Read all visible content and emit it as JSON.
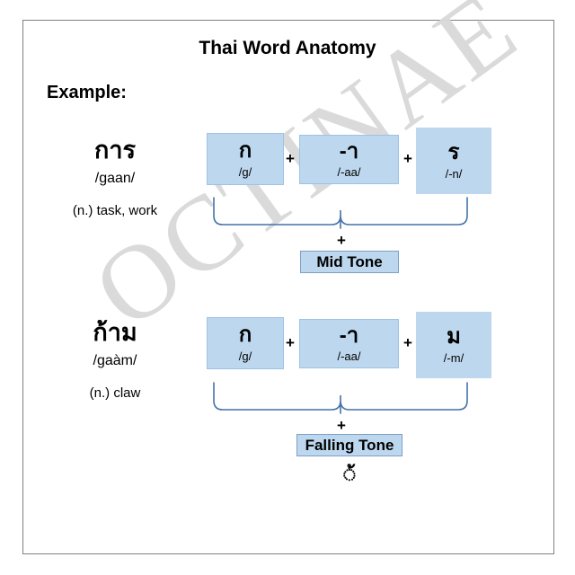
{
  "document": {
    "title": "Thai Word Anatomy",
    "example_label": "Example:"
  },
  "watermark": {
    "text": "OCTINAE"
  },
  "colors": {
    "box_fill": "#bdd7ee",
    "box_border": "#9dc3e6",
    "brace_stroke": "#4472a8",
    "frame_border": "#808080",
    "text": "#000000",
    "watermark": "#d9d9d9"
  },
  "entries": [
    {
      "thai": "การ",
      "phonetic": "/gaan/",
      "gloss": "(n.) task, work",
      "components": [
        {
          "glyph": "ก",
          "phonetic": "/g/"
        },
        {
          "glyph": "-า",
          "phonetic": "/-aa/"
        },
        {
          "glyph": "ร",
          "phonetic": "/-n/"
        }
      ],
      "operators": [
        "+",
        "+"
      ],
      "combine_operator": "+",
      "tone": "Mid Tone",
      "tone_mark": ""
    },
    {
      "thai": "ก้าม",
      "phonetic": "/gaàm/",
      "gloss": "(n.) claw",
      "components": [
        {
          "glyph": "ก",
          "phonetic": "/g/"
        },
        {
          "glyph": "-า",
          "phonetic": "/-aa/"
        },
        {
          "glyph": "ม",
          "phonetic": "/-m/"
        }
      ],
      "operators": [
        "+",
        "+"
      ],
      "combine_operator": "+",
      "tone": "Falling Tone",
      "tone_mark": "◌้"
    }
  ]
}
